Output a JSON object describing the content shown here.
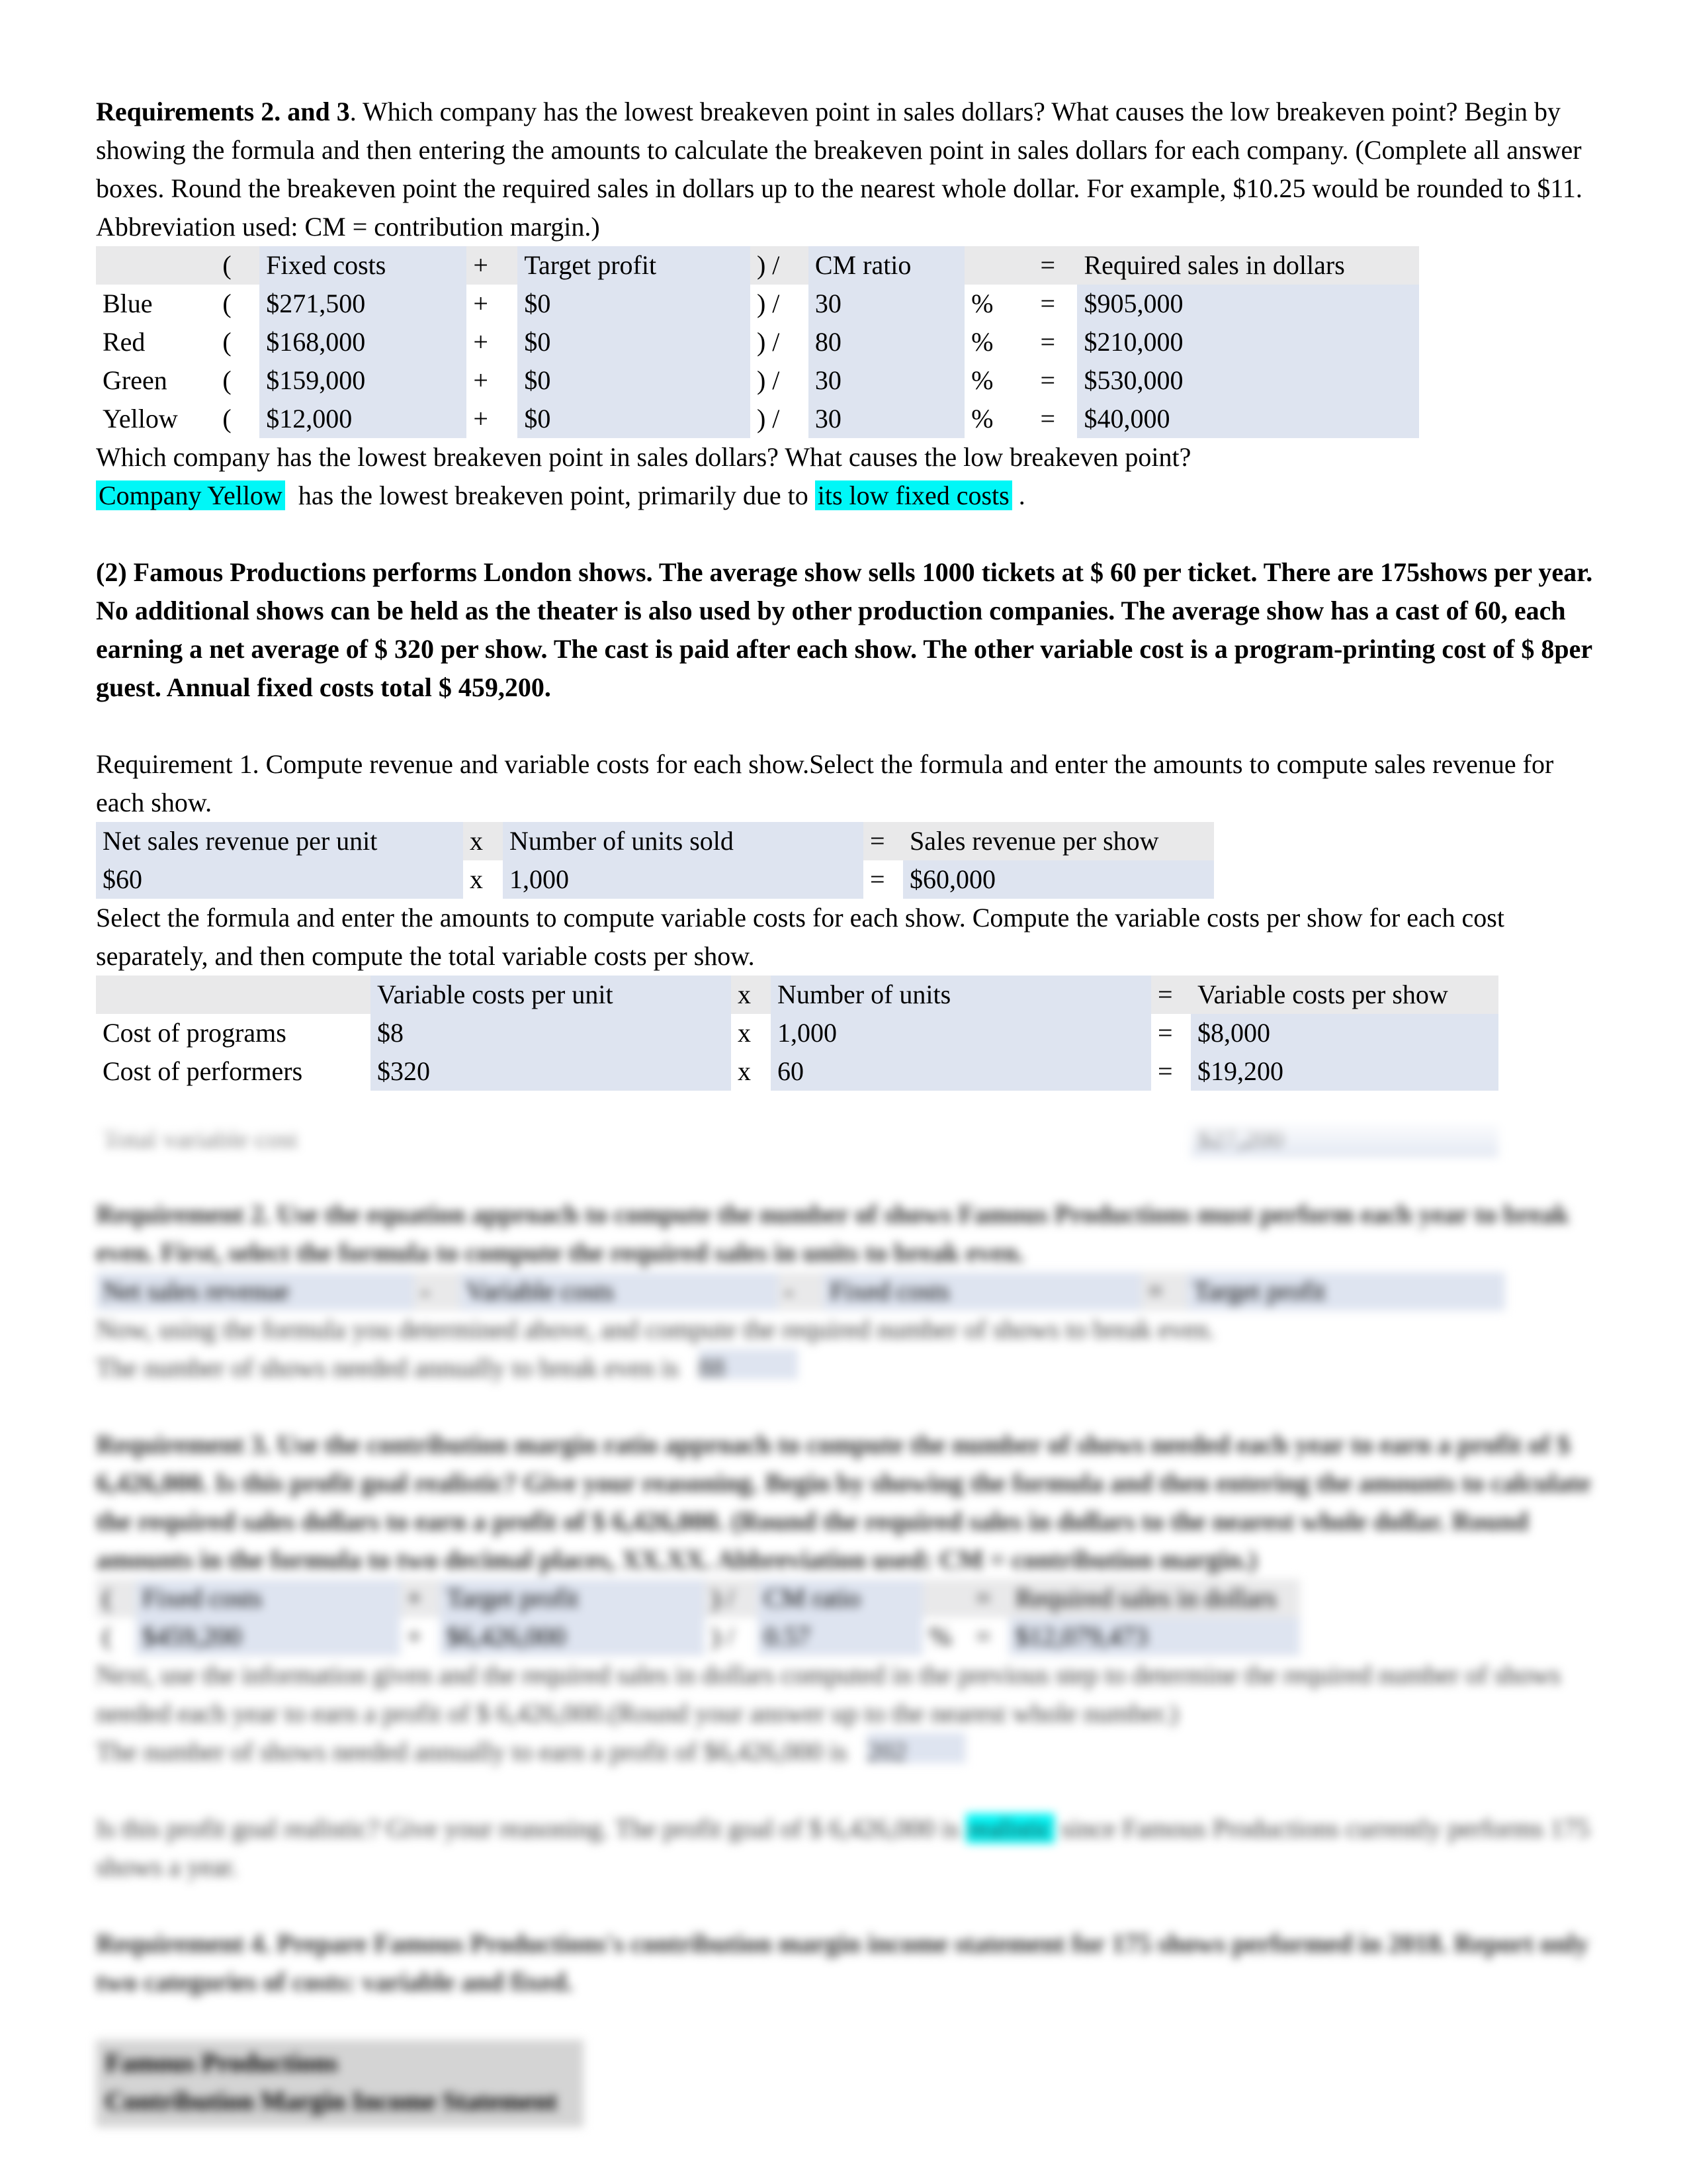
{
  "document": {
    "req23": {
      "heading_bold": "Requirements 2. and 3",
      "intro": ". Which company has the lowest breakeven point in sales dollars? What causes the low breakeven point? Begin by showing the formula and then entering the amounts to calculate the breakeven point in sales dollars for each company. (Complete all answer boxes. Round the breakeven point the required sales in dollars up to the nearest whole dollar. For example, $10.25 would be rounded to $11. Abbreviation used: CM = contribution margin.)",
      "table": {
        "headers": [
          "",
          "(",
          "Fixed costs",
          "+",
          "Target profit",
          ") /",
          "CM ratio",
          "",
          "=",
          "Required sales in dollars"
        ],
        "rows": [
          {
            "company": "Blue",
            "open": "(",
            "fixed_costs": "$271,500",
            "plus": "+",
            "target_profit": "$0",
            "close": ") /",
            "cm_ratio": "30",
            "pct": "%",
            "eq": "=",
            "required_sales": "$905,000"
          },
          {
            "company": "Red",
            "open": "(",
            "fixed_costs": "$168,000",
            "plus": "+",
            "target_profit": "$0",
            "close": ") /",
            "cm_ratio": "80",
            "pct": "%",
            "eq": "=",
            "required_sales": "$210,000"
          },
          {
            "company": "Green",
            "open": "(",
            "fixed_costs": "$159,000",
            "plus": "+",
            "target_profit": "$0",
            "close": ") /",
            "cm_ratio": "30",
            "pct": "%",
            "eq": "=",
            "required_sales": "$530,000"
          },
          {
            "company": "Yellow",
            "open": "(",
            "fixed_costs": "$12,000",
            "plus": "+",
            "target_profit": "$0",
            "close": ") /",
            "cm_ratio": "30",
            "pct": "%",
            "eq": "=",
            "required_sales": "$40,000"
          }
        ]
      },
      "question": "Which company has the lowest breakeven point in sales dollars? What causes the low breakeven point?",
      "answer": {
        "blank1": "Company Yellow",
        "mid": "has the lowest breakeven point, primarily due to",
        "blank2": "its low fixed costs",
        "end": "."
      }
    },
    "problem2": {
      "text": "(2) Famous Productions performs London shows. The average show sells 1000 tickets at $ 60 per ticket. There are 175shows per year. No additional shows can be held as the theater is also used by other production companies. The average show has a cast of 60, each earning a net average of $ 320 per show. The cast is paid after each show. The other variable cost is a program-printing cost of $ 8per guest. Annual fixed costs total $ 459,200."
    },
    "req1": {
      "intro": "Requirement 1. Compute revenue and variable costs for each show.Select the formula and enter the amounts to compute sales revenue for each show.",
      "revenue_table": {
        "headers": [
          "Net sales revenue per unit",
          "x",
          "Number of units sold",
          "=",
          "Sales revenue per show"
        ],
        "row": [
          "$60",
          "x",
          "1,000",
          "=",
          "$60,000"
        ]
      },
      "vc_intro": "Select the formula and enter the amounts to compute variable costs for each show. Compute the variable costs per show for each cost separately, and then compute the total variable costs per show.",
      "vc_table": {
        "headers": [
          "",
          "Variable costs per unit",
          "x",
          "Number of units",
          "=",
          "Variable costs per show"
        ],
        "rows": [
          {
            "label": "Cost of programs",
            "per_unit": "$8",
            "x": "x",
            "units": "1,000",
            "eq": "=",
            "per_show": "$8,000"
          },
          {
            "label": "Cost of performers",
            "per_unit": "$320",
            "x": "x",
            "units": "60",
            "eq": "=",
            "per_show": "$19,200"
          },
          {
            "label": "Total variable cost",
            "per_unit": "",
            "x": "",
            "units": "",
            "eq": "",
            "per_show": "$27,200"
          }
        ]
      }
    },
    "req2_blurred": {
      "intro": "Requirement 2. Use the equation approach to compute the number of shows Famous Productions must perform each year to break even. First, select the formula to compute the required sales in units to break even.",
      "formula_headers": [
        "Net sales revenue",
        "-",
        "Variable costs",
        "-",
        "Fixed costs",
        "=",
        "Target profit"
      ],
      "line2": "Now, using the formula you determined above, and compute the required number of shows to break even.",
      "line3": "The number of shows needed annually to break even is",
      "answer_box": "88"
    },
    "req3_blurred": {
      "intro": "Requirement 3. Use the contribution margin ratio approach to compute the number of shows needed each year to earn a profit of $ 6,426,000. Is this profit goal realistic? Give your reasoning. Begin by showing the formula and then entering the amounts to calculate the required sales dollars to earn a profit of $ 6,426,000. (Round the required sales in dollars to the nearest whole dollar. Round amounts in the formula to two decimal places, XX.XX. Abbreviation used: CM = contribution margin.)",
      "table_headers": [
        "(",
        "Fixed costs",
        "+",
        "Target profit",
        ") /",
        "CM ratio",
        "=",
        "Required sales in dollars"
      ],
      "table_row": [
        "(",
        "$459,200",
        "+",
        "$6,426,000",
        ") /",
        "0.57",
        "%",
        "=",
        "$12,079,473"
      ],
      "line2": "Next, use the information given and the required sales in dollars computed in the previous step to determine the required number of shows needed each year to earn a profit of $ 6,426,000.(Round your answer up to the nearest whole number.)",
      "line3": "The number of shows needed annually to earn a profit of $6,426,000 is",
      "answer_box": "202",
      "line4_a": "Is this profit goal realistic? Give your reasoning. The profit goal of $ 6,426,000 is",
      "line4_hl": "realistic",
      "line4_b": "since Famous Productions currently performs 175 shows a year."
    },
    "req4_blurred": {
      "intro": "Requirement 4. Prepare Famous Productions's contribution margin income statement for 175 shows performed in 2018. Report only two categories of costs: variable and fixed.",
      "statement_title_line1": "Famous Productions",
      "statement_title_line2": "Contribution Margin Income Statement"
    }
  }
}
